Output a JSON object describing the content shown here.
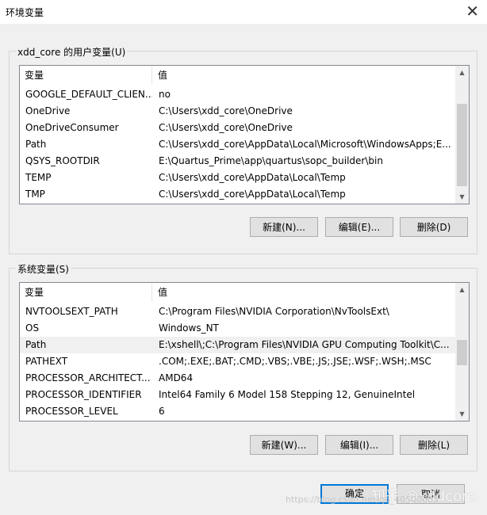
{
  "window": {
    "title": "环境变量",
    "close_glyph": "✕"
  },
  "user_vars": {
    "group_label": "xdd_core 的用户变量(U)",
    "col_name": "变量",
    "col_value": "值",
    "rows": [
      {
        "name": "GOOGLE_DEFAULT_CLIEN...",
        "value": "no"
      },
      {
        "name": "OneDrive",
        "value": "C:\\Users\\xdd_core\\OneDrive"
      },
      {
        "name": "OneDriveConsumer",
        "value": "C:\\Users\\xdd_core\\OneDrive"
      },
      {
        "name": "Path",
        "value": "C:\\Users\\xdd_core\\AppData\\Local\\Microsoft\\WindowsApps;E..."
      },
      {
        "name": "QSYS_ROOTDIR",
        "value": "E:\\Quartus_Prime\\app\\quartus\\sopc_builder\\bin"
      },
      {
        "name": "TEMP",
        "value": "C:\\Users\\xdd_core\\AppData\\Local\\Temp"
      },
      {
        "name": "TMP",
        "value": "C:\\Users\\xdd_core\\AppData\\Local\\Temp"
      }
    ],
    "buttons": {
      "new": "新建(N)...",
      "edit": "编辑(E)...",
      "delete": "删除(D)"
    }
  },
  "system_vars": {
    "group_label": "系统变量(S)",
    "col_name": "变量",
    "col_value": "值",
    "rows": [
      {
        "name": "NVTOOLSEXT_PATH",
        "value": "C:\\Program Files\\NVIDIA Corporation\\NvToolsExt\\"
      },
      {
        "name": "OS",
        "value": "Windows_NT"
      },
      {
        "name": "Path",
        "value": "E:\\xshell\\;C:\\Program Files\\NVIDIA GPU Computing Toolkit\\C..."
      },
      {
        "name": "PATHEXT",
        "value": ".COM;.EXE;.BAT;.CMD;.VBS;.VBE;.JS;.JSE;.WSF;.WSH;.MSC"
      },
      {
        "name": "PROCESSOR_ARCHITECT...",
        "value": "AMD64"
      },
      {
        "name": "PROCESSOR_IDENTIFIER",
        "value": "Intel64 Family 6 Model 158 Stepping 12, GenuineIntel"
      },
      {
        "name": "PROCESSOR_LEVEL",
        "value": "6"
      }
    ],
    "buttons": {
      "new": "新建(W)...",
      "edit": "编辑(I)...",
      "delete": "删除(L)"
    }
  },
  "footer": {
    "ok": "确定",
    "cancel": "取消"
  },
  "watermark": {
    "text": "知乎 @xddcore",
    "url": "https://blog.csdn.net/qq_40500005"
  },
  "colors": {
    "accent": "#0078d7",
    "selected_row": "#f0f0f0"
  }
}
